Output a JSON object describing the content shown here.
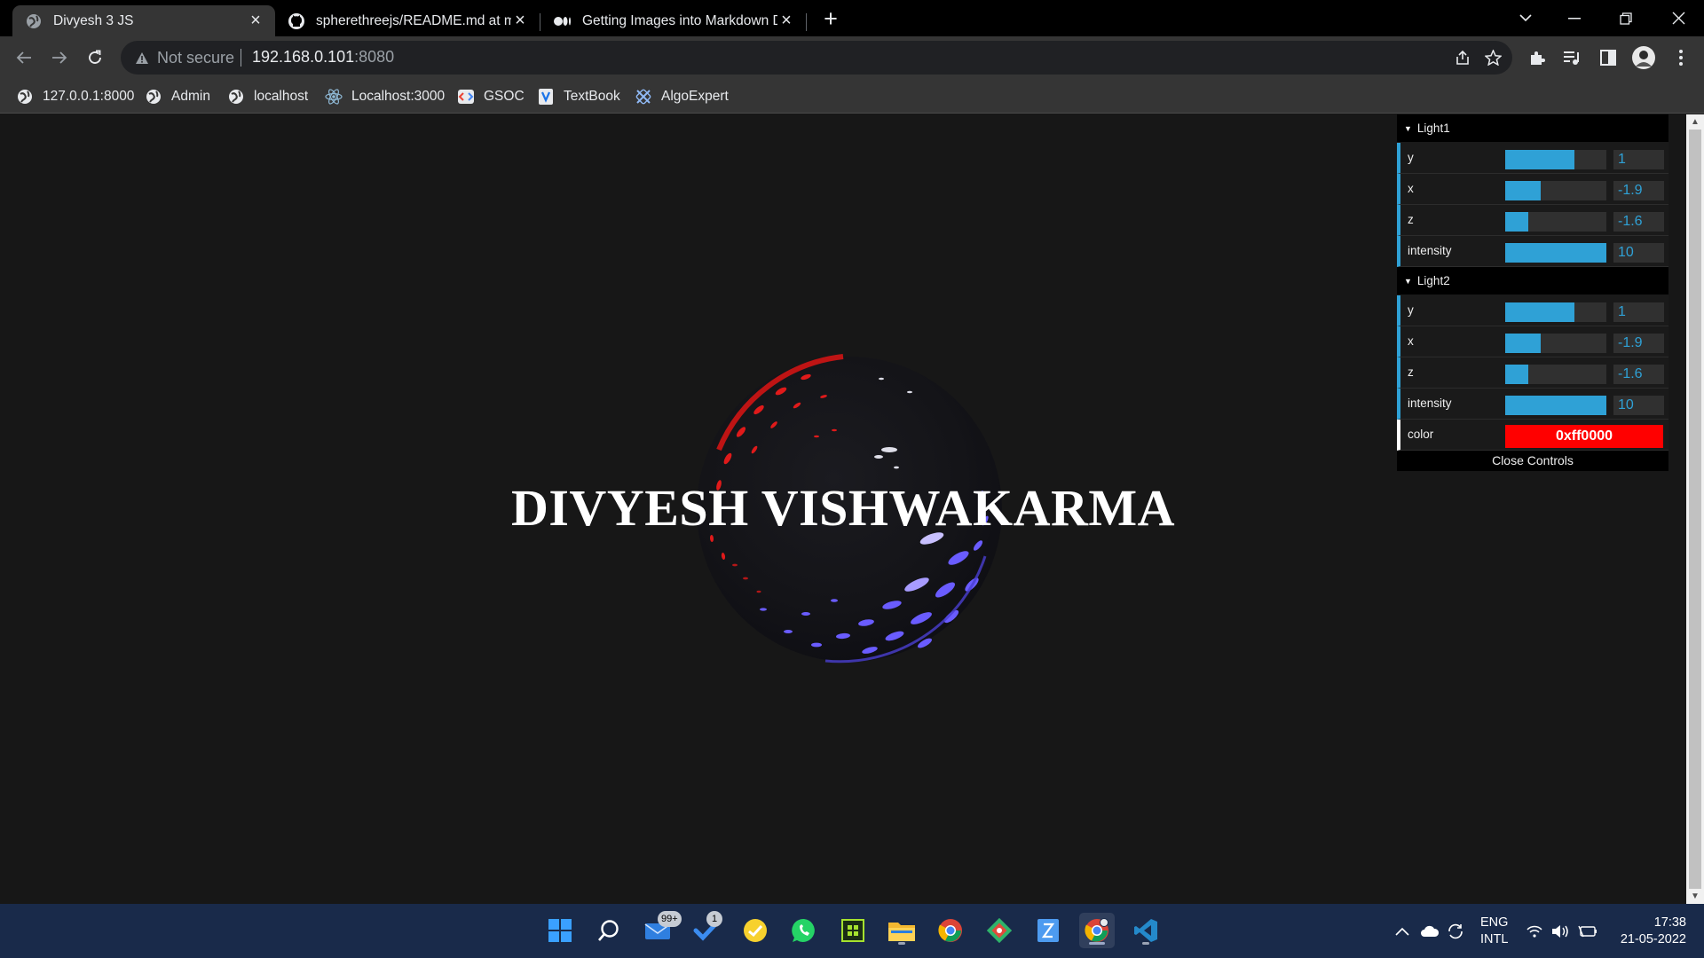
{
  "browser": {
    "tabs": [
      {
        "title": "Divyesh 3 JS",
        "icon": "globe-icon",
        "active": true
      },
      {
        "title": "spherethreejs/README.md at ma",
        "icon": "github-icon",
        "active": false
      },
      {
        "title": "Getting Images into Markdown D",
        "icon": "medium-icon",
        "active": false
      }
    ],
    "new_tab_label": "+",
    "address": {
      "security_label": "Not secure",
      "host": "192.168.0.101",
      "port": ":8080"
    },
    "bookmarks": [
      {
        "label": "127.0.0.1:8000",
        "icon": "globe-icon"
      },
      {
        "label": "Admin",
        "icon": "globe-icon"
      },
      {
        "label": "localhost",
        "icon": "globe-icon"
      },
      {
        "label": "Localhost:3000",
        "icon": "react-icon"
      },
      {
        "label": "GSOC",
        "icon": "gsoc-icon"
      },
      {
        "label": "TextBook",
        "icon": "textbook-icon"
      },
      {
        "label": "AlgoExpert",
        "icon": "algoexpert-icon"
      }
    ]
  },
  "page": {
    "hero_text": "DIVYESH VISHWAKARMA"
  },
  "gui": {
    "folders": [
      {
        "title": "Light1",
        "controls": [
          {
            "label": "y",
            "value": "1",
            "level": 0.68
          },
          {
            "label": "x",
            "value": "-1.9",
            "level": 0.35
          },
          {
            "label": "z",
            "value": "-1.6",
            "level": 0.23
          },
          {
            "label": "intensity",
            "value": "10",
            "level": 1.0
          }
        ]
      },
      {
        "title": "Light2",
        "controls": [
          {
            "label": "y",
            "value": "1",
            "level": 0.68
          },
          {
            "label": "x",
            "value": "-1.9",
            "level": 0.35
          },
          {
            "label": "z",
            "value": "-1.6",
            "level": 0.23
          },
          {
            "label": "intensity",
            "value": "10",
            "level": 1.0
          }
        ],
        "color": {
          "label": "color",
          "value": "0xff0000",
          "swatch": "#ff0000"
        }
      }
    ],
    "close_label": "Close Controls",
    "accent": "#2fa1d6"
  },
  "taskbar": {
    "apps": [
      {
        "name": "start-icon"
      },
      {
        "name": "search-icon"
      },
      {
        "name": "mail-icon",
        "badge": "99+"
      },
      {
        "name": "todo-icon",
        "badge": "1"
      },
      {
        "name": "sticky-notes-icon"
      },
      {
        "name": "whatsapp-icon"
      },
      {
        "name": "app-grid-icon"
      },
      {
        "name": "file-explorer-icon"
      },
      {
        "name": "chrome-icon"
      },
      {
        "name": "git-icon"
      },
      {
        "name": "editor-icon"
      },
      {
        "name": "chrome-dev-icon",
        "active": true
      },
      {
        "name": "vscode-icon",
        "running": true
      }
    ],
    "tray": {
      "lang_line1": "ENG",
      "lang_line2": "INTL",
      "time": "17:38",
      "date": "21-05-2022"
    }
  }
}
